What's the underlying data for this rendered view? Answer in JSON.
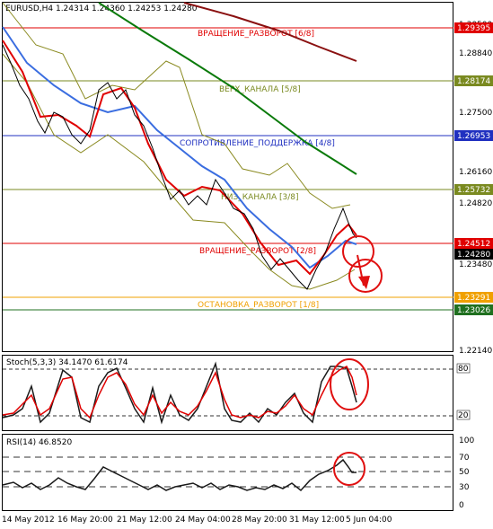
{
  "symbol_header": "EURUSD,H4  1.24314 1.24360 1.24253 1.24280",
  "colors": {
    "price": "#000000",
    "ma_red": "#e00000",
    "ma_blue": "#3a6de0",
    "bollinger": "#8a8a20",
    "ma_green": "#0a7a0a",
    "ma_maroon": "#8a1010",
    "level_red": "#e00000",
    "level_olive": "#7a8a20",
    "level_blue": "#2030c0",
    "level_orange": "#f0a000",
    "level_green": "#207020",
    "annotation": "#e01010",
    "stoch_main": "#000000",
    "stoch_signal": "#e00000",
    "rsi_line": "#1a1a1a"
  },
  "price_axis_ticks": [
    "1.30500",
    "1.28840",
    "1.27500",
    "1.26160",
    "1.24820",
    "1.23480",
    "1.22140"
  ],
  "levels": [
    {
      "label": "ВРАЩЕНИЕ_РАЗВОРОТ [6/8]",
      "value": "1.29395",
      "price": 1.29395,
      "color": "#e00000",
      "text_color": "#e00000"
    },
    {
      "label": "ВЕРХ_КАНАЛА [5/8]",
      "value": "1.28174",
      "price": 1.28174,
      "color": "#7a8a20",
      "text_color": "#7a8a20"
    },
    {
      "label": "СОПРОТИВЛЕНИЕ_ПОДДЕРЖКА [4/8]",
      "value": "1.26953",
      "price": 1.26953,
      "color": "#2030c0",
      "text_color": "#2030c0"
    },
    {
      "label": "НИЗ_КАНАЛА [3/8]",
      "value": "1.25732",
      "price": 1.25732,
      "color": "#7a8a20",
      "text_color": "#7a8a20"
    },
    {
      "label": "ВРАЩЕНИЕ_РАЗВОРОТ [2/8]",
      "value": "1.24512",
      "price": 1.24512,
      "color": "#e00000",
      "text_color": "#e00000"
    },
    {
      "label": "ОСТАНОВКА_РАЗВОРОТ [1/8]",
      "value": "1.23291",
      "price": 1.23291,
      "color": "#f0a000",
      "text_color": "#f0a000"
    },
    {
      "label": "",
      "value": "1.23026",
      "price": 1.23026,
      "color": "#207020",
      "text_color": "#207020"
    }
  ],
  "current_price": {
    "value": "1.24280",
    "price": 1.2428
  },
  "stoch": {
    "label": "Stoch(5,3,3) 34.1470 61.6174",
    "levels": [
      "80",
      "20"
    ]
  },
  "rsi": {
    "label": "RSI(14) 46.8520",
    "ticks": [
      "100",
      "70",
      "50",
      "30",
      "0"
    ]
  },
  "time_axis": [
    "14 May 2012",
    "16 May 20:00",
    "21 May 12:00",
    "24 May 04:00",
    "28 May 20:00",
    "31 May 12:00",
    "5 Jun 04:00"
  ],
  "chart_data": {
    "type": "line",
    "title": "EURUSD,H4",
    "x": [
      "14 May 2012",
      "16 May 20:00",
      "21 May 12:00",
      "24 May 04:00",
      "28 May 20:00",
      "31 May 12:00",
      "5 Jun 04:00"
    ],
    "ylim": [
      1.2214,
      1.305
    ],
    "series": [
      {
        "name": "EURUSD",
        "values": [
          1.2905,
          1.28,
          1.2785,
          1.266,
          1.252,
          1.247,
          1.243,
          1.2345,
          1.242,
          1.2428
        ]
      }
    ],
    "indicators": [
      {
        "name": "Stoch(5,3,3)",
        "values": [
          34.147,
          61.6174
        ]
      },
      {
        "name": "RSI(14)",
        "values": [
          46.852
        ]
      }
    ]
  }
}
